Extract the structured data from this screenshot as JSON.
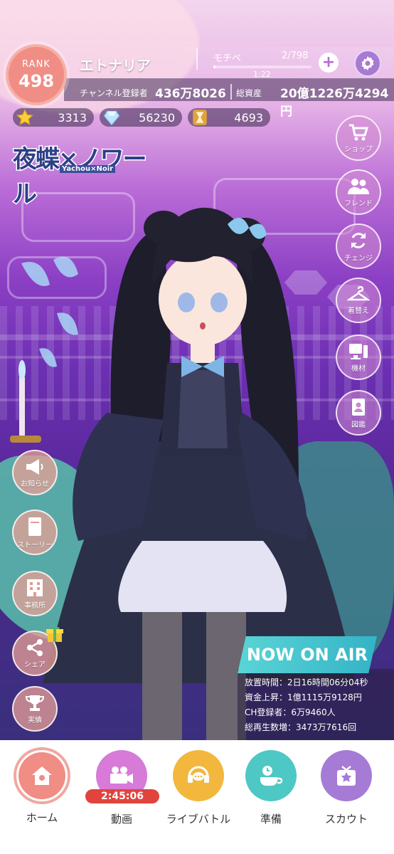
{
  "header": {
    "rank_label": "RANK",
    "rank_value": "498",
    "player_name": "エトナリア",
    "motive_label": "モチベ",
    "motive_count": "2/798",
    "motive_fraction": 0.0025,
    "motive_timer": "1:22",
    "subscribers_label": "チャンネル登録者",
    "subscribers_value": "436万8026",
    "assets_label": "総資産",
    "assets_value": "20億1226万4294円"
  },
  "currencies": [
    {
      "icon": "star-icon",
      "value": "3313"
    },
    {
      "icon": "diamond-icon",
      "value": "56230"
    },
    {
      "icon": "hourglass-icon",
      "value": "4693"
    }
  ],
  "logo": {
    "title": "夜蝶×ノワール",
    "subtitle": "Yachou×Noir"
  },
  "right_menu": [
    {
      "label": "ショップ",
      "icon": "cart-icon"
    },
    {
      "label": "フレンド",
      "icon": "friends-icon"
    },
    {
      "label": "チェンジ",
      "icon": "change-icon"
    },
    {
      "label": "着替え",
      "icon": "hanger-icon"
    },
    {
      "label": "機材",
      "icon": "equipment-icon"
    },
    {
      "label": "図鑑",
      "icon": "book-icon"
    }
  ],
  "left_menu": [
    {
      "label": "お知らせ",
      "icon": "megaphone-icon"
    },
    {
      "label": "ストーリー",
      "icon": "story-book-icon"
    },
    {
      "label": "事務所",
      "icon": "office-icon"
    },
    {
      "label": "シェア",
      "icon": "share-icon"
    },
    {
      "label": "実績",
      "icon": "trophy-icon"
    }
  ],
  "onair": {
    "title": "NOW ON AIR",
    "lines": [
      "放置時間：2日16時間06分04秒",
      "資金上昇：1億1115万9128円",
      "CH登録者：6万9460人",
      "総再生数増：3473万7616回"
    ]
  },
  "bottom_nav": [
    {
      "label": "ホーム",
      "icon": "home-icon",
      "color": "#f08d84"
    },
    {
      "label": "動画",
      "icon": "video-camera-icon",
      "color": "#d77ad8"
    },
    {
      "label": "ライブバトル",
      "icon": "headset-icon",
      "color": "#f3b73d"
    },
    {
      "label": "準備",
      "icon": "coffee-icon",
      "color": "#4ec8c4"
    },
    {
      "label": "スカウト",
      "icon": "scout-tv-icon",
      "color": "#a67bd6"
    }
  ],
  "video_timer": "2:45:06"
}
